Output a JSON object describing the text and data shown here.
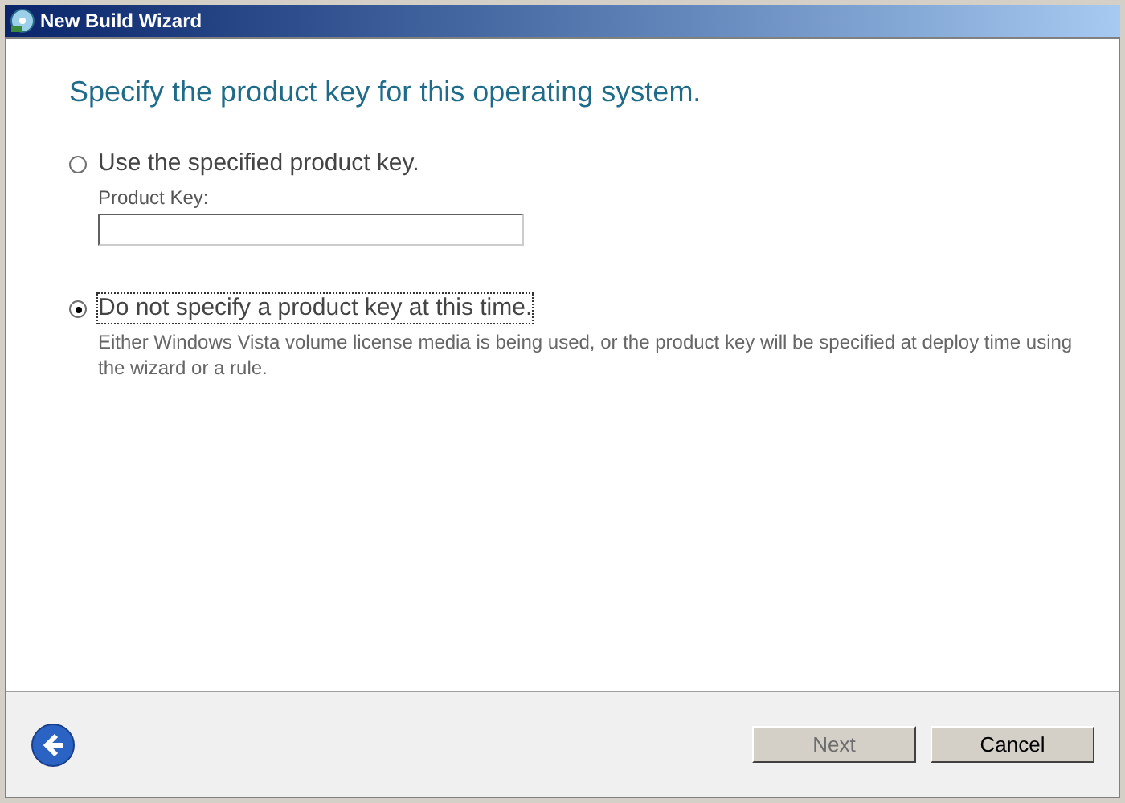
{
  "window": {
    "title": "New Build Wizard"
  },
  "heading": "Specify the product key for this operating system.",
  "options": [
    {
      "label": "Use the specified product key.",
      "selected": false,
      "field": {
        "label": "Product Key:"
      }
    },
    {
      "label": "Do not specify a product key at this time.",
      "selected": true,
      "description": "Either Windows Vista volume license media is being used, or the product key will be specified at deploy time using the wizard or a rule."
    }
  ],
  "buttons": [
    {
      "label": "Next",
      "disabled": true
    },
    {
      "label": "Cancel",
      "disabled": false
    }
  ]
}
